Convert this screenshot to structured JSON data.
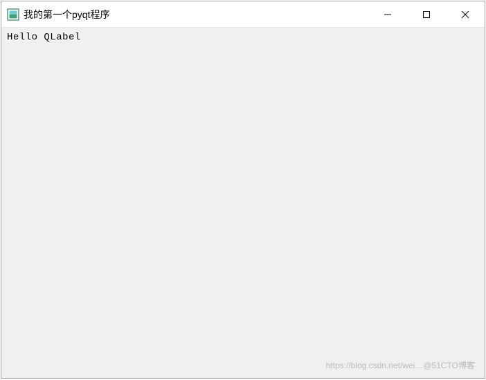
{
  "window": {
    "title": "我的第一个pyqt程序"
  },
  "content": {
    "label": "Hello QLabel"
  },
  "watermark": {
    "text": "https://blog.csdn.net/wei…@51CTO博客"
  }
}
